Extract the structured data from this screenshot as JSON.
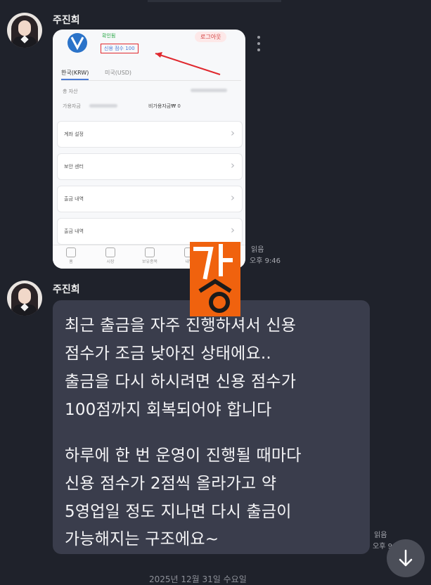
{
  "messages": [
    {
      "sender": "주진희",
      "read_label": "읽음",
      "time": "오후 9:46",
      "screenshot": {
        "verify_badge": "확인됨",
        "credit_badge": "신용 점수 100",
        "logout_button": "로그아웃",
        "tabs": [
          "한국(KRW)",
          "미국(USD)"
        ],
        "total_assets_label": "총 자산",
        "available_label": "가용자금",
        "non_available_label": "비가용자금₩ 0",
        "menu_items": [
          "계좌 설정",
          "보안 센터",
          "출금 내역",
          "출금 내역"
        ],
        "nav_items": [
          "홈",
          "시장",
          "보유종목",
          "내역"
        ]
      }
    },
    {
      "sender": "주진희",
      "read_label": "읽음",
      "time": "오후 9:46",
      "lines": [
        "최근 출금을 자주 진행하셔서 신용",
        "점수가 조금 낮아진 상태에요..",
        "출금을 다시 하시려면 신용 점수가",
        "100점까지 회복되어야 합니다",
        "",
        "하루에 한 번 운영이 진행될 때마다",
        "신용 점수가 2점씩 올라가고 약",
        "5영업일 정도 지나면 다시 출금이",
        "가능해지는 구조에요~"
      ]
    }
  ],
  "date_divider": "2025년 12월 31일 수요일",
  "colors": {
    "background": "#1f222b",
    "bubble": "#3a3d4c",
    "watermark": "#f0620e"
  }
}
